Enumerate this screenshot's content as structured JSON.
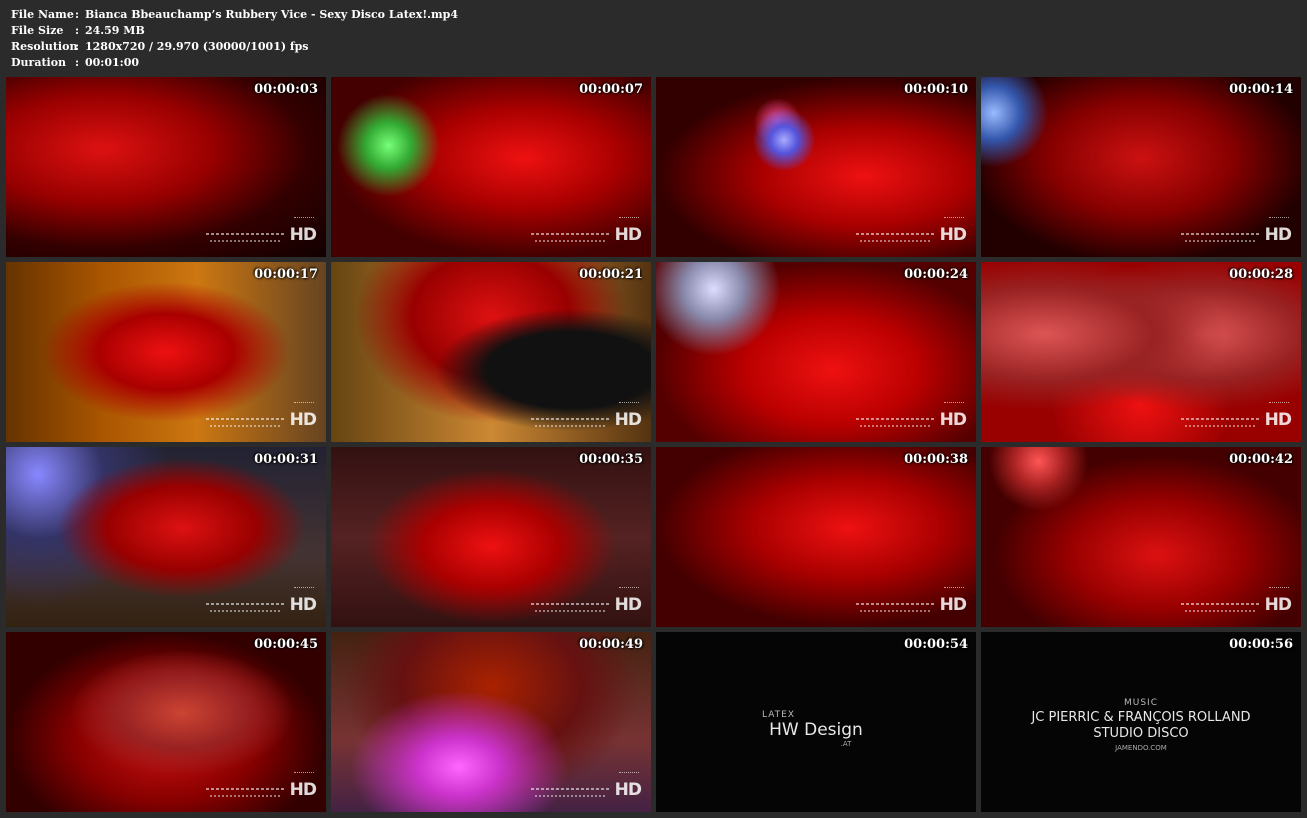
{
  "info": {
    "file_name_label": "File Name",
    "file_name": "Bianca Bbeauchamp’s Rubbery Vice - Sexy Disco Latex!.mp4",
    "file_size_label": "File Size",
    "file_size": "24.59 MB",
    "resolution_label": "Resolution",
    "resolution": "1280x720 / 29.970 (30000/1001) fps",
    "duration_label": "Duration",
    "duration": "00:01:00",
    "separator": ":"
  },
  "thumbnails": [
    {
      "time": "00:00:03"
    },
    {
      "time": "00:00:07"
    },
    {
      "time": "00:00:10"
    },
    {
      "time": "00:00:14"
    },
    {
      "time": "00:00:17"
    },
    {
      "time": "00:00:21"
    },
    {
      "time": "00:00:24"
    },
    {
      "time": "00:00:28"
    },
    {
      "time": "00:00:31"
    },
    {
      "time": "00:00:35"
    },
    {
      "time": "00:00:38"
    },
    {
      "time": "00:00:42"
    },
    {
      "time": "00:00:45"
    },
    {
      "time": "00:00:49"
    },
    {
      "time": "00:00:54"
    },
    {
      "time": "00:00:56"
    }
  ],
  "watermark": {
    "hd": "HD"
  },
  "credits": {
    "design_sub": "LATEX",
    "design_main": "HW Design",
    "design_at": ".AT",
    "music_sub": "MUSIC",
    "music_main": "JC PIERRIC & FRANÇOIS ROLLAND",
    "music_line": "STUDIO DISCO",
    "music_at": "JAMENDO.COM"
  }
}
